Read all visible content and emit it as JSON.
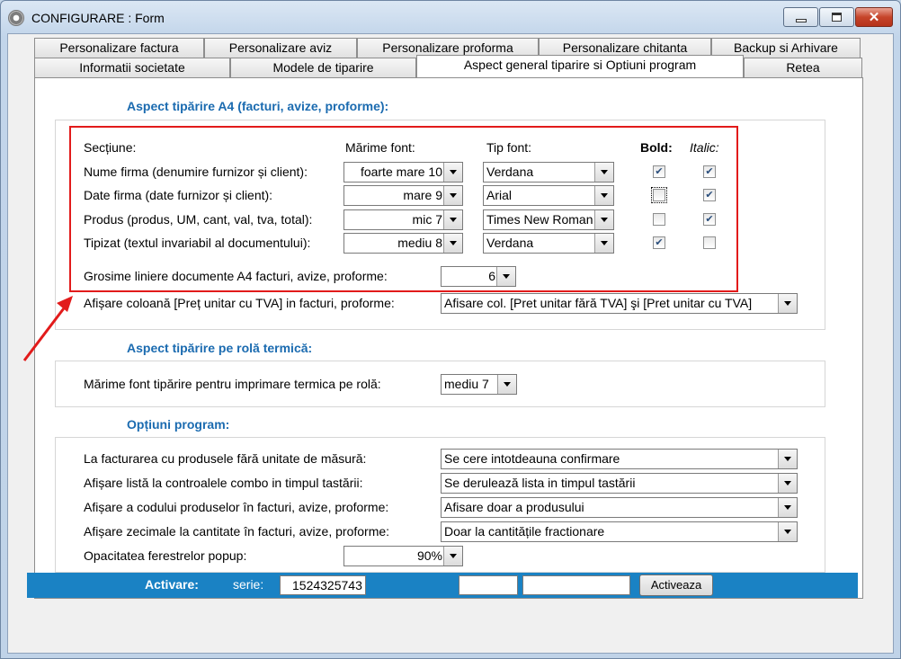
{
  "window": {
    "title": "CONFIGURARE : Form"
  },
  "tabs_row1": [
    "Personalizare factura",
    "Personalizare aviz",
    "Personalizare proforma",
    "Personalizare chitanta",
    "Backup si Arhivare"
  ],
  "tabs_row2": [
    "Informatii societate",
    "Modele de tiparire",
    "Aspect general tiparire si Optiuni program",
    "Retea"
  ],
  "a4": {
    "title": "Aspect tipărire A4 (facturi, avize, proforme):",
    "headers": {
      "section": "Secțiune:",
      "font_size": "Mărime font:",
      "font_type": "Tip font:",
      "bold": "Bold:",
      "italic": "Italic:"
    },
    "rows": [
      {
        "label": "Nume firma (denumire furnizor și client):",
        "size": "foarte mare 10",
        "font": "Verdana",
        "bold": true,
        "italic": true
      },
      {
        "label": "Date firma (date furnizor și client):",
        "size": "mare 9",
        "font": "Arial",
        "bold": false,
        "italic": true
      },
      {
        "label": "Produs (produs, UM, cant, val, tva, total):",
        "size": "mic 7",
        "font": "Times New Roman",
        "bold": false,
        "italic": true
      },
      {
        "label": "Tipizat (textul invariabil al documentului):",
        "size": "mediu 8",
        "font": "Verdana",
        "bold": true,
        "italic": false
      }
    ],
    "line_thickness_label": "Grosime liniere documente A4 facturi, avize, proforme:",
    "line_thickness_value": "6",
    "column_label": "Afișare coloană [Preț unitar cu TVA] in facturi, proforme:",
    "column_value": "Afisare col. [Pret unitar fără TVA] şi [Pret unitar cu TVA]"
  },
  "thermal": {
    "title": "Aspect tipărire pe rolă termică:",
    "font_label": "Mărime font tipărire pentru imprimare termica pe rolă:",
    "font_value": "mediu 7"
  },
  "options": {
    "title": "Opțiuni program:",
    "rows": [
      {
        "label": "La facturarea cu produsele fără unitate de măsură:",
        "value": "Se cere intotdeauna confirmare"
      },
      {
        "label": "Afișare listă la controalele combo in timpul tastării:",
        "value": "Se derulează lista in timpul tastării"
      },
      {
        "label": "Afișare a codului produselor în facturi, avize, proforme:",
        "value": "Afisare doar a produsului"
      },
      {
        "label": "Afișare zecimale la cantitate în facturi, avize, proforme:",
        "value": "Doar la cantitățile fractionare"
      }
    ],
    "opacity_label": "Opacitatea ferestrelor popup:",
    "opacity_value": "90%"
  },
  "activation": {
    "label": "Activare:",
    "serie_label": "serie:",
    "serie_value": "1524325743",
    "field2": "",
    "field3": "",
    "button": "Activeaza"
  },
  "colors": {
    "accent": "#1b6bb0",
    "status_bar": "#1a82c4",
    "highlight": "#e21b1b"
  },
  "icons": [
    "app-gear-icon",
    "minimize-icon",
    "maximize-icon",
    "close-icon",
    "dropdown-arrow-icon",
    "checkmark-icon",
    "annotation-arrow-icon"
  ]
}
